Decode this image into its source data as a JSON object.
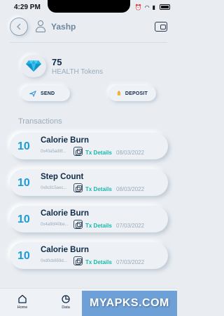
{
  "status_bar": {
    "time": "4:29 PM"
  },
  "header": {
    "username": "Yashp"
  },
  "wallet": {
    "amount": "75",
    "token_label": "HEALTH Tokens"
  },
  "actions": {
    "send_label": "SEND",
    "deposit_label": "DEPOSIT"
  },
  "transactions": {
    "title": "Transactions",
    "items": [
      {
        "amount": "10",
        "name": "Calorie Burn",
        "hash": "0x40a5ad8f...",
        "details_label": "Tx Details",
        "date": "08/03/2022"
      },
      {
        "amount": "10",
        "name": "Step Count",
        "hash": "0x8c815aec...",
        "details_label": "Tx Details",
        "date": "08/03/2022"
      },
      {
        "amount": "10",
        "name": "Calorie Burn",
        "hash": "0x4a9bf40be...",
        "details_label": "Tx Details",
        "date": "07/03/2022"
      },
      {
        "amount": "10",
        "name": "Calorie Burn",
        "hash": "0xd0cb659d...",
        "details_label": "Tx Details",
        "date": "07/03/2022"
      }
    ]
  },
  "bottom_nav": {
    "home_label": "Home",
    "data_label": "Data"
  },
  "watermark": {
    "text": "MYAPKS.COM"
  },
  "colors": {
    "accent_blue": "#1c9bd6",
    "accent_teal": "#19b7a9",
    "background": "#e9edf2",
    "text_dark": "#0f2a47"
  },
  "icons": [
    "back-arrow-icon",
    "user-icon",
    "wallet-icon",
    "diamond-icon",
    "send-icon",
    "deposit-icon",
    "copy-icon",
    "home-icon",
    "data-icon"
  ]
}
